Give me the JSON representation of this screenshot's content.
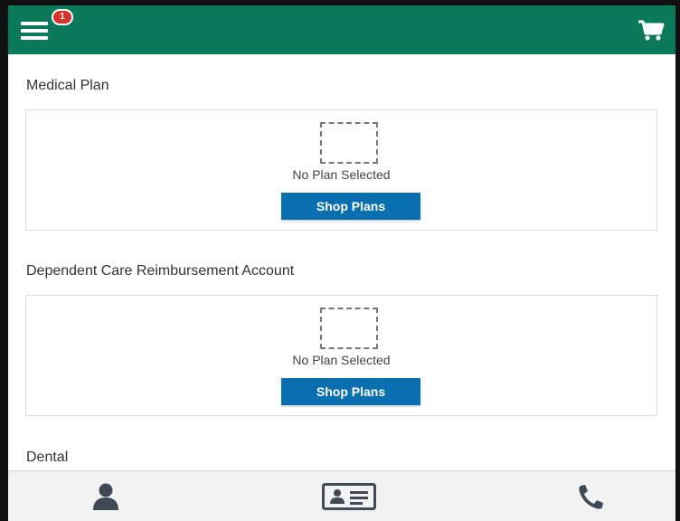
{
  "header": {
    "menu_icon": "hamburger-menu-icon",
    "notification_count": "1",
    "cart_icon": "shopping-cart-icon",
    "colors": {
      "header_bg": "#0b7a5b",
      "badge_bg": "#d9342b"
    }
  },
  "sections": [
    {
      "title": "Medical Plan",
      "status_text": "No Plan Selected",
      "button_label": "Shop Plans"
    },
    {
      "title": "Dependent Care Reimbursement Account",
      "status_text": "No Plan Selected",
      "button_label": "Shop Plans"
    },
    {
      "title": "Dental"
    }
  ],
  "bottom_nav": {
    "items": [
      {
        "icon": "person-icon"
      },
      {
        "icon": "id-card-icon"
      },
      {
        "icon": "phone-icon"
      }
    ],
    "colors": {
      "icon": "#3f4a56"
    }
  },
  "colors": {
    "button_bg": "#0a6fb0"
  }
}
